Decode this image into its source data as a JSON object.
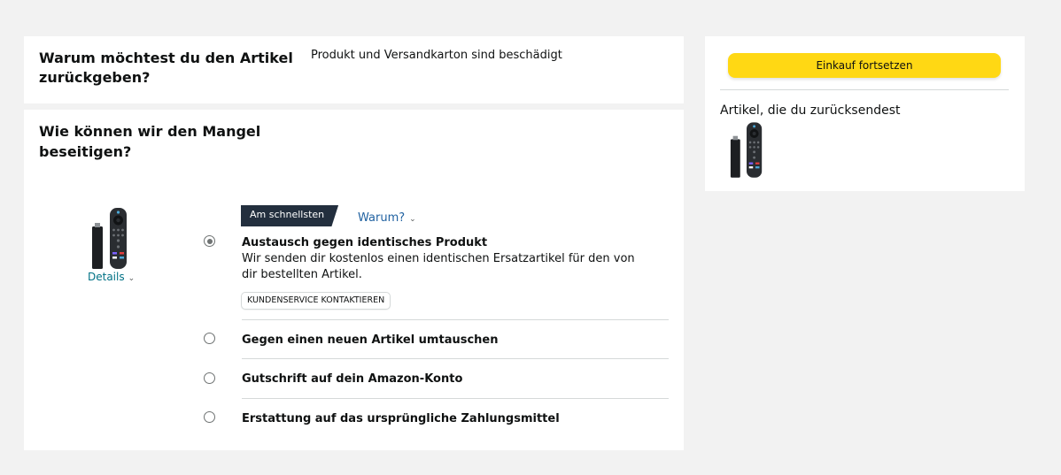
{
  "reason": {
    "heading": "Warum möchtest du den Artikel zurückgeben?",
    "value": "Produkt und Versandkarton sind beschädigt"
  },
  "remedy": {
    "heading": "Wie können wir den Mangel beseitigen?",
    "details_link": "Details",
    "fastest_badge": "Am schnellsten",
    "why_link": "Warum?",
    "options": [
      {
        "label": "Austausch gegen identisches Produkt",
        "description": "Wir senden dir kostenlos einen identischen Ersatzartikel für den von dir bestellten Artikel.",
        "button": "KUNDENSERVICE KONTAKTIEREN",
        "selected": true
      },
      {
        "label": "Gegen einen neuen Artikel umtauschen",
        "selected": false
      },
      {
        "label": "Gutschrift auf dein Amazon-Konto",
        "selected": false
      },
      {
        "label": "Erstattung auf das ursprüngliche Zahlungsmittel",
        "selected": false
      }
    ]
  },
  "sidebar": {
    "continue_button": "Einkauf fortsetzen",
    "items_title": "Artikel, die du zurücksendest"
  },
  "colors": {
    "continue_button": "#ffd814",
    "badge": "#232f3e",
    "link": "#007185"
  },
  "icons": {
    "product": "fire-tv-stick-remote-image",
    "chevron": "chevron-down-icon"
  }
}
